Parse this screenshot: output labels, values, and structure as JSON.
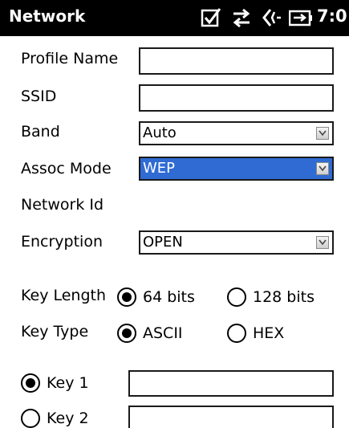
{
  "titlebar": {
    "title": "Network",
    "clock": "7:0",
    "icons": [
      "checkbox-icon",
      "data-transfer-icon",
      "speaker-muted-icon",
      "battery-charging-icon"
    ]
  },
  "form": {
    "profile_name": {
      "label": "Profile Name",
      "value": ""
    },
    "ssid": {
      "label": "SSID",
      "value": ""
    },
    "band": {
      "label": "Band",
      "value": "Auto"
    },
    "assoc_mode": {
      "label": "Assoc Mode",
      "value": "WEP"
    },
    "network_id": {
      "label": "Network Id"
    },
    "encryption": {
      "label": "Encryption",
      "value": "OPEN"
    },
    "key_length": {
      "label": "Key Length",
      "options": [
        "64 bits",
        "128 bits"
      ],
      "selected": "64 bits"
    },
    "key_type": {
      "label": "Key Type",
      "options": [
        "ASCII",
        "HEX"
      ],
      "selected": "ASCII"
    },
    "keys": [
      {
        "label": "Key 1",
        "value": "",
        "selected": true
      },
      {
        "label": "Key 2",
        "value": "",
        "selected": false
      }
    ]
  },
  "colors": {
    "titlebar_bg": "#000000",
    "selection": "#2f6bd3"
  }
}
